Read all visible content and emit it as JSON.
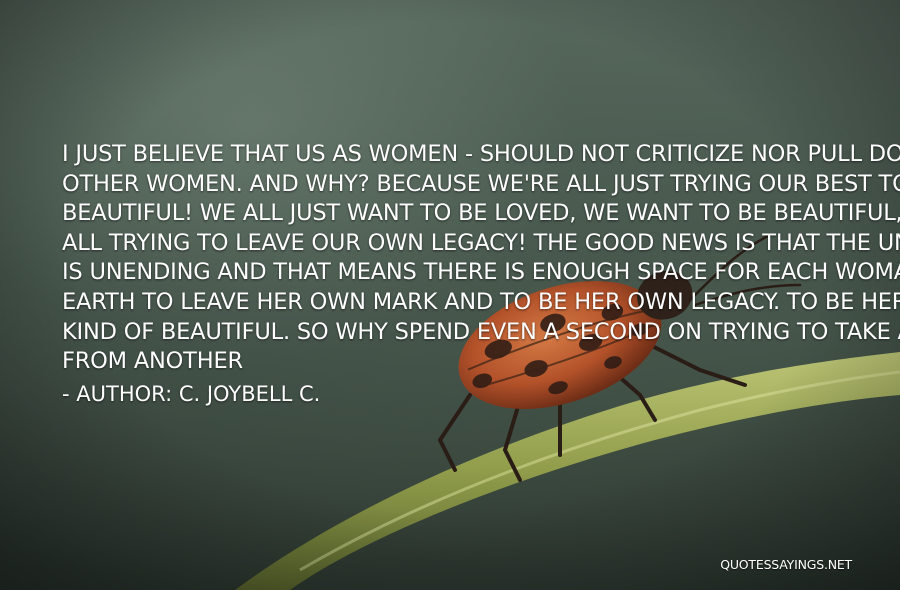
{
  "quote": {
    "lines": [
      "I JUST BELIEVE THAT US AS WOMEN - SHOULD NOT CRITICIZE NOR PULL DOWN",
      "OTHER WOMEN. AND WHY? BECAUSE WE'RE ALL JUST TRYING OUR BEST TO BE",
      "BEAUTIFUL! WE ALL JUST WANT TO BE LOVED, WE WANT TO BE BEAUTIFUL, WE'RE",
      "ALL TRYING TO LEAVE OUR OWN LEGACY! THE GOOD NEWS IS THAT THE UNIVERSE",
      "IS UNENDING AND THAT MEANS THERE IS ENOUGH SPACE FOR EACH WOMAN ON",
      "EARTH TO LEAVE HER OWN MARK AND TO BE HER OWN LEGACY. TO BE HER OWN",
      "KIND OF BEAUTIFUL. SO WHY SPEND EVEN A SECOND ON TRYING TO TAKE AWAY",
      "FROM ANOTHER"
    ],
    "author": "- AUTHOR: C. JOYBELL C."
  },
  "watermark": "QUOTESSAYINGS.NET",
  "colors": {
    "text": "#ffffff",
    "background": "#3e4c43",
    "stem": "#a7b25a",
    "insect_body": "#b3522a",
    "insect_spots": "#2a1a14"
  },
  "icons": {
    "background_photo": "insect-on-plant-stem"
  }
}
